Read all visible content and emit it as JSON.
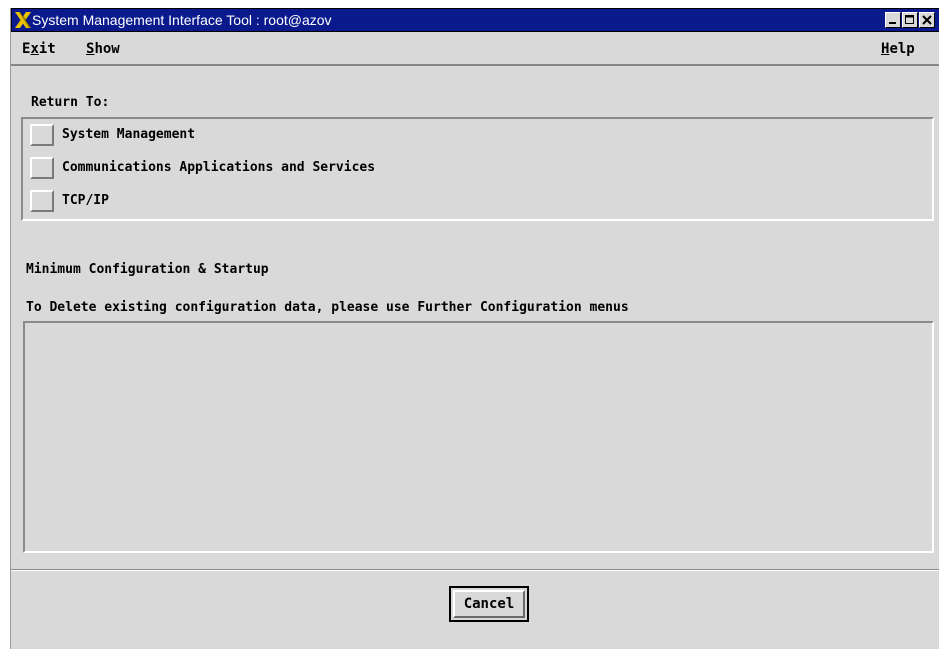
{
  "window": {
    "title": "System Management Interface Tool : root@azov",
    "icon": "x-logo-icon",
    "controls": [
      "minimize-icon",
      "maximize-icon",
      "close-icon"
    ]
  },
  "menubar": {
    "exit": {
      "pre": "E",
      "mn": "x",
      "post": "it"
    },
    "show": {
      "pre": "",
      "mn": "S",
      "post": "how"
    },
    "help": {
      "pre": "",
      "mn": "H",
      "post": "elp"
    }
  },
  "return_to": {
    "label": "Return To:",
    "items": [
      {
        "label": "System Management"
      },
      {
        "label": "Communications Applications and Services"
      },
      {
        "label": "TCP/IP"
      }
    ]
  },
  "main": {
    "heading": "Minimum Configuration & Startup",
    "instruction": "To Delete existing configuration data, please use Further Configuration menus"
  },
  "footer": {
    "cancel_label": "Cancel"
  },
  "colors": {
    "titlebar": "#0a1a8c",
    "background": "#d9d9d9",
    "logo": "#e8c200"
  }
}
